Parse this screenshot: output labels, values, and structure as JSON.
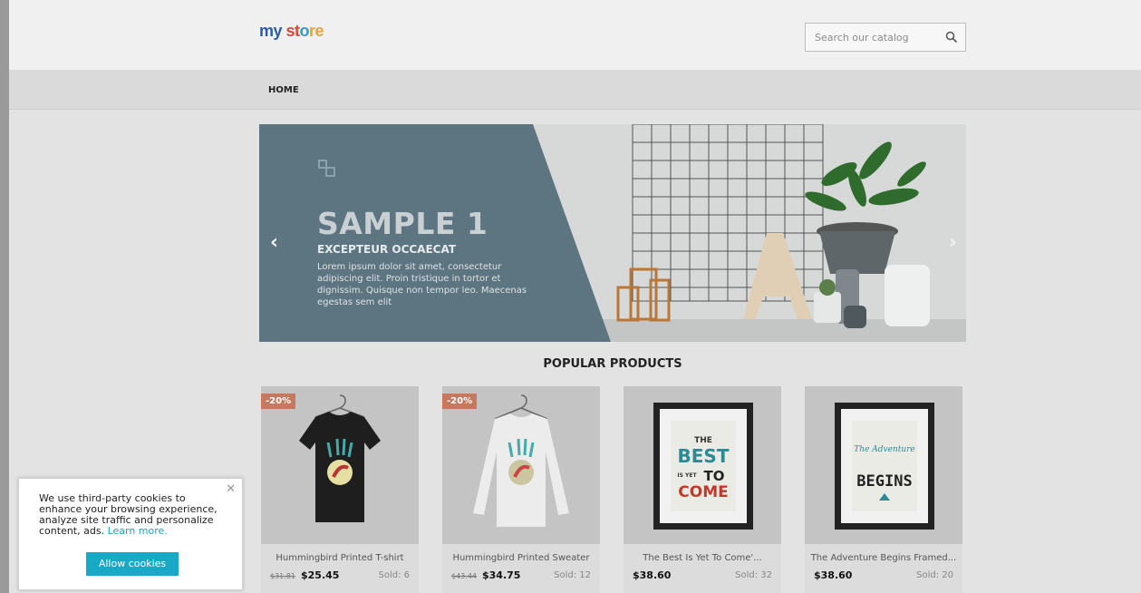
{
  "header": {
    "logo": [
      "my",
      " ",
      "st",
      "o",
      "re"
    ],
    "search_placeholder": "Search our catalog"
  },
  "nav": {
    "home": "HOME"
  },
  "slider": {
    "title": "SAMPLE 1",
    "subtitle": "EXCEPTEUR OCCAECAT",
    "description": "Lorem ipsum dolor sit amet, consectetur adipiscing elit. Proin tristique in tortor et dignissim. Quisque non tempor leo. Maecenas egestas sem elit",
    "prev": "‹",
    "next": "›",
    "icons": [
      "chevron-left-icon",
      "chevron-right-icon"
    ]
  },
  "popular": {
    "title": "POPULAR PRODUCTS"
  },
  "products": [
    {
      "name": "Hummingbird Printed T-shirt",
      "badge": "-20%",
      "old_price": "$31.81",
      "price": "$25.45",
      "sold": "Sold: 6"
    },
    {
      "name": "Hummingbird Printed Sweater",
      "badge": "-20%",
      "old_price": "$43.44",
      "price": "$34.75",
      "sold": "Sold: 12"
    },
    {
      "name": "The Best Is Yet To Come'...",
      "badge": "",
      "old_price": "",
      "price": "$38.60",
      "sold": "Sold: 32"
    },
    {
      "name": "The Adventure Begins Framed...",
      "badge": "",
      "old_price": "",
      "price": "$38.60",
      "sold": "Sold: 20"
    }
  ],
  "poster_best": {
    "the": "THE",
    "best": "BEST",
    "is_yet": "IS YET",
    "to": "TO",
    "come": "COME"
  },
  "poster_adventure": {
    "the_adventure": "The Adventure",
    "begins": "BEGINS"
  },
  "cookie": {
    "text": "We use third-party cookies to enhance your browsing experience, analyze site traffic and personalize content, ads. ",
    "learn_more": "Learn more.",
    "button": "Allow cookies",
    "close": "✕"
  },
  "colors": {
    "accent": "#19a9c7",
    "badge": "#c8795d",
    "slide_panel": "#5d7581"
  }
}
